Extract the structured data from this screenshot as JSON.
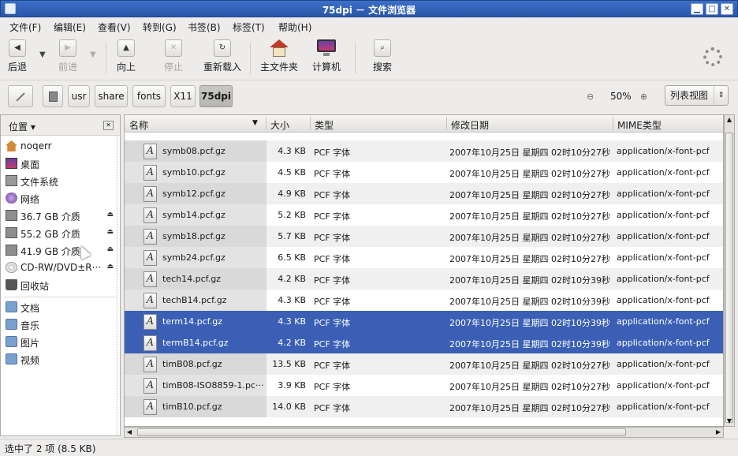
{
  "window": {
    "title": "75dpi － 文件浏览器"
  },
  "menubar": [
    "文件(F)",
    "编辑(E)",
    "查看(V)",
    "转到(G)",
    "书签(B)",
    "标签(T)",
    "帮助(H)"
  ],
  "toolbar": {
    "back": "后退",
    "forward": "前进",
    "up": "向上",
    "stop": "停止",
    "reload": "重新载入",
    "home": "主文件夹",
    "computer": "计算机",
    "search": "搜索"
  },
  "path": [
    "usr",
    "share",
    "fonts",
    "X11",
    "75dpi"
  ],
  "zoom": {
    "value": "50%"
  },
  "view": {
    "selected": "列表视图"
  },
  "sidebar": {
    "header": "位置",
    "places": [
      {
        "label": "noqerr",
        "icon": "home-icon"
      },
      {
        "label": "桌面",
        "icon": "desktop-icon"
      },
      {
        "label": "文件系统",
        "icon": "filesystem-icon"
      },
      {
        "label": "网络",
        "icon": "network-icon"
      },
      {
        "label": "36.7 GB 介质",
        "icon": "drive-icon",
        "eject": true
      },
      {
        "label": "55.2 GB 介质",
        "icon": "drive-icon",
        "eject": true
      },
      {
        "label": "41.9 GB 介质",
        "icon": "drive-icon",
        "eject": true
      },
      {
        "label": "CD-RW/DVD±R···",
        "icon": "cdrom-icon",
        "eject": true
      },
      {
        "label": "回收站",
        "icon": "trash-icon"
      }
    ],
    "bookmarks": [
      {
        "label": "文档",
        "icon": "folder-icon"
      },
      {
        "label": "音乐",
        "icon": "folder-icon"
      },
      {
        "label": "图片",
        "icon": "folder-icon"
      },
      {
        "label": "视频",
        "icon": "folder-icon"
      }
    ]
  },
  "columns": {
    "name": "名称",
    "size": "大小",
    "type": "类型",
    "date": "修改日期",
    "mime": "MIME类型"
  },
  "files": [
    {
      "name": "symb08.pcf.gz",
      "size": "4.3 KB",
      "type": "PCF 字体",
      "date": "2007年10月25日 星期四 02时10分27秒",
      "mime": "application/x-font-pcf",
      "selected": false
    },
    {
      "name": "symb10.pcf.gz",
      "size": "4.5 KB",
      "type": "PCF 字体",
      "date": "2007年10月25日 星期四 02时10分27秒",
      "mime": "application/x-font-pcf",
      "selected": false
    },
    {
      "name": "symb12.pcf.gz",
      "size": "4.9 KB",
      "type": "PCF 字体",
      "date": "2007年10月25日 星期四 02时10分27秒",
      "mime": "application/x-font-pcf",
      "selected": false
    },
    {
      "name": "symb14.pcf.gz",
      "size": "5.2 KB",
      "type": "PCF 字体",
      "date": "2007年10月25日 星期四 02时10分27秒",
      "mime": "application/x-font-pcf",
      "selected": false
    },
    {
      "name": "symb18.pcf.gz",
      "size": "5.7 KB",
      "type": "PCF 字体",
      "date": "2007年10月25日 星期四 02时10分27秒",
      "mime": "application/x-font-pcf",
      "selected": false
    },
    {
      "name": "symb24.pcf.gz",
      "size": "6.5 KB",
      "type": "PCF 字体",
      "date": "2007年10月25日 星期四 02时10分27秒",
      "mime": "application/x-font-pcf",
      "selected": false
    },
    {
      "name": "tech14.pcf.gz",
      "size": "4.2 KB",
      "type": "PCF 字体",
      "date": "2007年10月25日 星期四 02时10分39秒",
      "mime": "application/x-font-pcf",
      "selected": false
    },
    {
      "name": "techB14.pcf.gz",
      "size": "4.3 KB",
      "type": "PCF 字体",
      "date": "2007年10月25日 星期四 02时10分39秒",
      "mime": "application/x-font-pcf",
      "selected": false
    },
    {
      "name": "term14.pcf.gz",
      "size": "4.3 KB",
      "type": "PCF 字体",
      "date": "2007年10月25日 星期四 02时10分39秒",
      "mime": "application/x-font-pcf",
      "selected": true
    },
    {
      "name": "termB14.pcf.gz",
      "size": "4.2 KB",
      "type": "PCF 字体",
      "date": "2007年10月25日 星期四 02时10分39秒",
      "mime": "application/x-font-pcf",
      "selected": true
    },
    {
      "name": "timB08.pcf.gz",
      "size": "13.5 KB",
      "type": "PCF 字体",
      "date": "2007年10月25日 星期四 02时10分27秒",
      "mime": "application/x-font-pcf",
      "selected": false
    },
    {
      "name": "timB08-ISO8859-1.pc···",
      "size": "3.9 KB",
      "type": "PCF 字体",
      "date": "2007年10月25日 星期四 02时10分27秒",
      "mime": "application/x-font-pcf",
      "selected": false
    },
    {
      "name": "timB10.pcf.gz",
      "size": "14.0 KB",
      "type": "PCF 字体",
      "date": "2007年10月25日 星期四 02时10分27秒",
      "mime": "application/x-font-pcf",
      "selected": false
    }
  ],
  "status": "选中了 2 项 (8.5 KB)",
  "colors": {
    "titlebar": "#2f5fb5",
    "selection": "#3a5fb5"
  }
}
